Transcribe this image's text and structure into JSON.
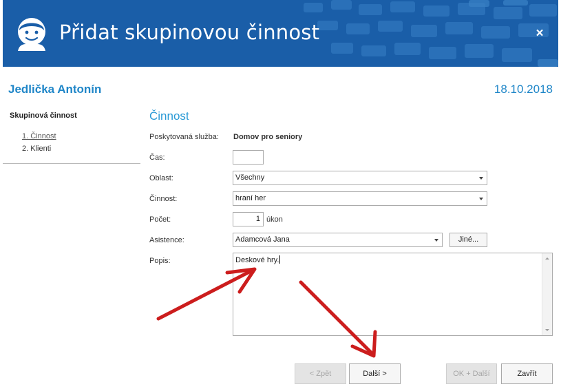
{
  "window": {
    "title": "Přidat skupinovou činnost",
    "close_symbol": "×"
  },
  "client": {
    "name": "Jedlička Antonín",
    "date": "18.10.2018"
  },
  "sidebar": {
    "heading": "Skupinová činnost",
    "steps": [
      {
        "label": "1. Činnost",
        "active": true
      },
      {
        "label": "2. Klienti",
        "active": false
      }
    ]
  },
  "form": {
    "section_title": "Činnost",
    "service": {
      "label": "Poskytovaná služba:",
      "value": "Domov pro seniory"
    },
    "time": {
      "label": "Čas:",
      "value": ""
    },
    "area": {
      "label": "Oblast:",
      "value": "Všechny"
    },
    "activity": {
      "label": "Činnost:",
      "value": "hraní her"
    },
    "count": {
      "label": "Počet:",
      "value": "1",
      "unit": "úkon"
    },
    "assistance": {
      "label": "Asistence:",
      "value": "Adamcová Jana",
      "other_button": "Jiné..."
    },
    "description": {
      "label": "Popis:",
      "value": "Deskové hry."
    }
  },
  "buttons": {
    "back": "< Zpět",
    "next": "Další >",
    "ok_next": "OK + Další",
    "close": "Zavřít"
  },
  "colors": {
    "header_bg": "#1a5ea8",
    "accent": "#1f86c8",
    "annotation_arrow": "#cc1d1d"
  },
  "icons": {
    "logo": "user-face-icon",
    "close": "close-icon",
    "annotation": "red-arrow-annotation"
  }
}
